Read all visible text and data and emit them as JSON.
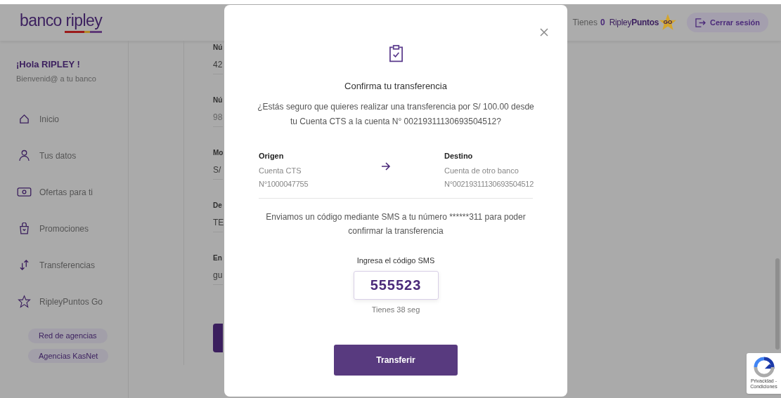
{
  "header": {
    "logo": "banco ripley",
    "points_label": "Tienes",
    "points_value": "0",
    "points_brand": "Ripley**Puntos**",
    "points_badge": "GO",
    "logout": "Cerrar sesión"
  },
  "sidebar": {
    "greeting": "¡Hola RIPLEY !",
    "subtitle": "Bienvenid@ a tu banco",
    "items": [
      {
        "label": "Inicio",
        "kind": "home"
      },
      {
        "label": "Tus datos",
        "kind": "user"
      },
      {
        "label": "Ofertas para ti",
        "kind": "money"
      },
      {
        "label": "Promociones",
        "kind": "bag"
      },
      {
        "label": "Transferencias",
        "kind": "transfer"
      },
      {
        "label": "RipleyPuntos Go",
        "kind": "star"
      }
    ],
    "links": [
      "Red de agencias",
      "Agencias KasNet"
    ]
  },
  "background_form": [
    {
      "label": "Nú",
      "value": "42",
      "kind": "value"
    },
    {
      "label": "Nú",
      "value": "98",
      "kind": "placeholder"
    },
    {
      "label": "Mo",
      "value": "S/",
      "kind": "value"
    },
    {
      "label": "De",
      "value": "TE",
      "kind": "value"
    },
    {
      "label": "En",
      "value": "gu",
      "kind": "value"
    }
  ],
  "modal": {
    "title": "Confirma tu transferencia",
    "question": "¿Estás seguro que quieres realizar una transferencia por S/ 100.00 desde tu Cuenta CTS a la cuenta N° 00219311130693504512?",
    "origin": {
      "heading": "Origen",
      "account": "Cuenta CTS",
      "number": "N°1000047755"
    },
    "destination": {
      "heading": "Destino",
      "account": "Cuenta de otro banco",
      "number": "N°00219311130693504512"
    },
    "sms_notice": "Enviamos un código mediante SMS a tu número ******311 para poder confirmar la transferencia",
    "code_label": "Ingresa el código SMS",
    "code_value": "555523",
    "timer": "Tienes 38 seg",
    "submit": "Transferir"
  },
  "recaptcha": {
    "text": "Privacidad - Condiciones"
  }
}
